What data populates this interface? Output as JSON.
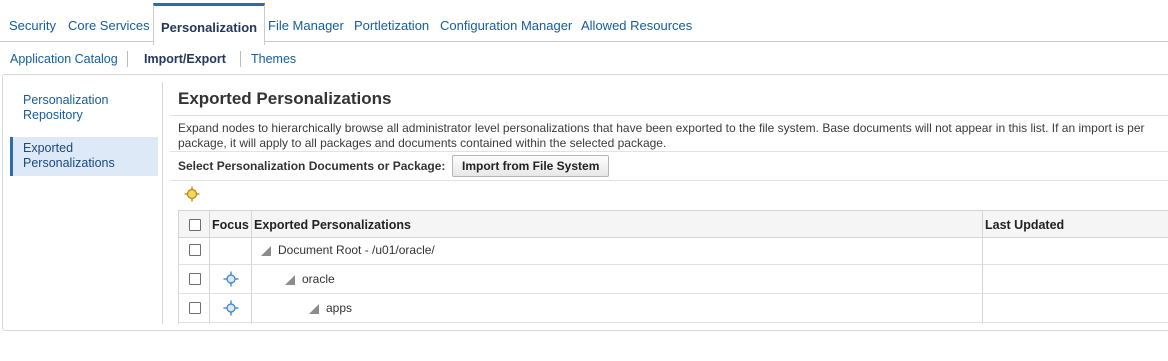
{
  "top_tabs": [
    "Security",
    "Core Services",
    "Personalization",
    "File Manager",
    "Portletization",
    "Configuration Manager",
    "Allowed Resources"
  ],
  "sub_tabs": [
    "Application Catalog",
    "Import/Export",
    "Themes"
  ],
  "left_nav": [
    "Personalization Repository",
    "Exported Personalizations"
  ],
  "content": {
    "title": "Exported Personalizations",
    "description_line1": "Expand nodes to hierarchically browse all administrator level personalizations that have been exported to the file system. Base documents will not appear in this list. If an import is per",
    "description_line2": "package, it will apply to all packages and documents contained within the selected package.",
    "select_label": "Select Personalization Documents or Package:",
    "import_button": "Import from File System"
  },
  "table": {
    "headers": [
      "Focus",
      "Exported Personalizations",
      "Last Updated"
    ],
    "rows": [
      {
        "name": "Document Root - /u01/oracle/",
        "last_updated": ""
      },
      {
        "name": "oracle",
        "last_updated": ""
      },
      {
        "name": "apps",
        "last_updated": ""
      }
    ]
  },
  "colors": {
    "link": "#145c9e",
    "active_tab_border": "#2b6da8",
    "nav_selected_bg": "#dde9f7",
    "focus_icon": "#3c7dc4",
    "toolbar_icon": "#d4a017"
  },
  "icons": [
    "focus-toolbar-icon",
    "focus-icon",
    "expand-triangle-icon",
    "checkbox"
  ]
}
